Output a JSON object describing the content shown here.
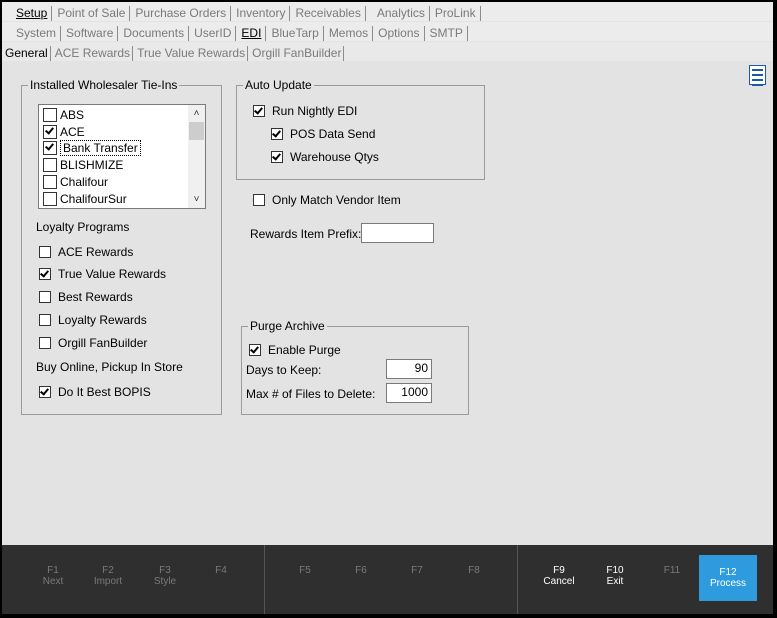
{
  "menu": {
    "row1": [
      {
        "label": "Setup",
        "active": true
      },
      {
        "label": "Point of Sale",
        "active": false
      },
      {
        "label": "Purchase Orders",
        "active": false
      },
      {
        "label": "Inventory",
        "active": false
      },
      {
        "label": "Receivables",
        "active": false
      },
      {
        "label": "Analytics",
        "active": false
      },
      {
        "label": "ProLink",
        "active": false
      }
    ],
    "row2": [
      {
        "label": "System",
        "active": false
      },
      {
        "label": "Software",
        "active": false
      },
      {
        "label": "Documents",
        "active": false
      },
      {
        "label": "UserID",
        "active": false
      },
      {
        "label": "EDI",
        "active": true
      },
      {
        "label": "BlueTarp",
        "active": false
      },
      {
        "label": "Memos",
        "active": false
      },
      {
        "label": "Options",
        "active": false
      },
      {
        "label": "SMTP",
        "active": false
      }
    ],
    "row3": [
      {
        "label": "General",
        "active": true
      },
      {
        "label": "ACE Rewards",
        "active": false
      },
      {
        "label": "True Value Rewards",
        "active": false
      },
      {
        "label": "Orgill FanBuilder",
        "active": false
      }
    ]
  },
  "menu_icon": "hamburger-menu-icon",
  "wholesaler": {
    "title": "Installed Wholesaler Tie-Ins",
    "items": [
      {
        "label": "ABS",
        "checked": false
      },
      {
        "label": "ACE",
        "checked": true
      },
      {
        "label": "Bank Transfer",
        "checked": true
      },
      {
        "label": "BLISHMIZE",
        "checked": false
      },
      {
        "label": "Chalifour",
        "checked": false
      },
      {
        "label": "ChalifourSur",
        "checked": false
      }
    ]
  },
  "loyalty": {
    "title": "Loyalty Programs",
    "items": [
      {
        "label": "ACE Rewards",
        "checked": false
      },
      {
        "label": "True Value Rewards",
        "checked": true
      },
      {
        "label": "Best Rewards",
        "checked": false
      },
      {
        "label": "Loyalty Rewards",
        "checked": false
      },
      {
        "label": "Orgill FanBuilder",
        "checked": false
      }
    ]
  },
  "bopis": {
    "title": "Buy Online, Pickup In Store",
    "item": {
      "label": "Do It Best BOPIS",
      "checked": true
    }
  },
  "auto_update": {
    "title": "Auto Update",
    "nightly": {
      "label": "Run Nightly EDI",
      "checked": true
    },
    "pos": {
      "label": "POS Data Send",
      "checked": true
    },
    "warehouse": {
      "label": "Warehouse Qtys",
      "checked": true
    }
  },
  "vendor": {
    "label": "Only Match Vendor Item",
    "checked": false
  },
  "rewards_prefix": {
    "label": "Rewards Item Prefix:",
    "value": ""
  },
  "purge": {
    "title": "Purge Archive",
    "enable": {
      "label": "Enable Purge",
      "checked": true
    },
    "days_label": "Days to Keep:",
    "days_value": "90",
    "max_label": "Max # of Files to Delete:",
    "max_value": "1000"
  },
  "fkeys": [
    {
      "key": "F1",
      "label": "Next",
      "enabled": false
    },
    {
      "key": "F2",
      "label": "Import",
      "enabled": false
    },
    {
      "key": "F3",
      "label": "Style",
      "enabled": false
    },
    {
      "key": "F4",
      "label": "",
      "enabled": false
    },
    {
      "key": "F5",
      "label": "",
      "enabled": false
    },
    {
      "key": "F6",
      "label": "",
      "enabled": false
    },
    {
      "key": "F7",
      "label": "",
      "enabled": false
    },
    {
      "key": "F8",
      "label": "",
      "enabled": false
    },
    {
      "key": "F9",
      "label": "Cancel",
      "enabled": true
    },
    {
      "key": "F10",
      "label": "Exit",
      "enabled": true
    },
    {
      "key": "F11",
      "label": "",
      "enabled": false
    },
    {
      "key": "F12",
      "label": "Process",
      "enabled": true
    }
  ],
  "colors": {
    "accent": "#2d9bde",
    "bar": "#2f2f2f",
    "background": "#e3e3e3"
  }
}
